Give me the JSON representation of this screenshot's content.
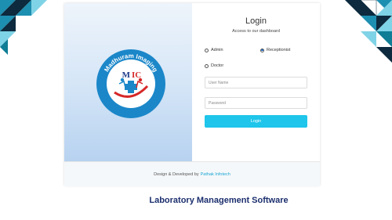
{
  "login": {
    "title": "Login",
    "subtitle": "Access to our dashboard",
    "roles": [
      {
        "label": "Admin",
        "selected": false
      },
      {
        "label": "Receptionist",
        "selected": true
      },
      {
        "label": "Doctor",
        "selected": false
      }
    ],
    "username_placeholder": "User Name",
    "password_placeholder": "Password",
    "submit_label": "Login"
  },
  "logo": {
    "name_top": "Madhuram Imaging",
    "name_bottom": "Center",
    "abbr_m": "M",
    "abbr_ic": "IC"
  },
  "footer": {
    "text": "Design & Developed by",
    "link": "Pathak Infotech"
  },
  "caption": "Laboratory Management Software",
  "colors": {
    "accent": "#1fc5ea",
    "caption": "#1c2f6e",
    "teal": "#0f7d95",
    "dark": "#0a2233"
  }
}
